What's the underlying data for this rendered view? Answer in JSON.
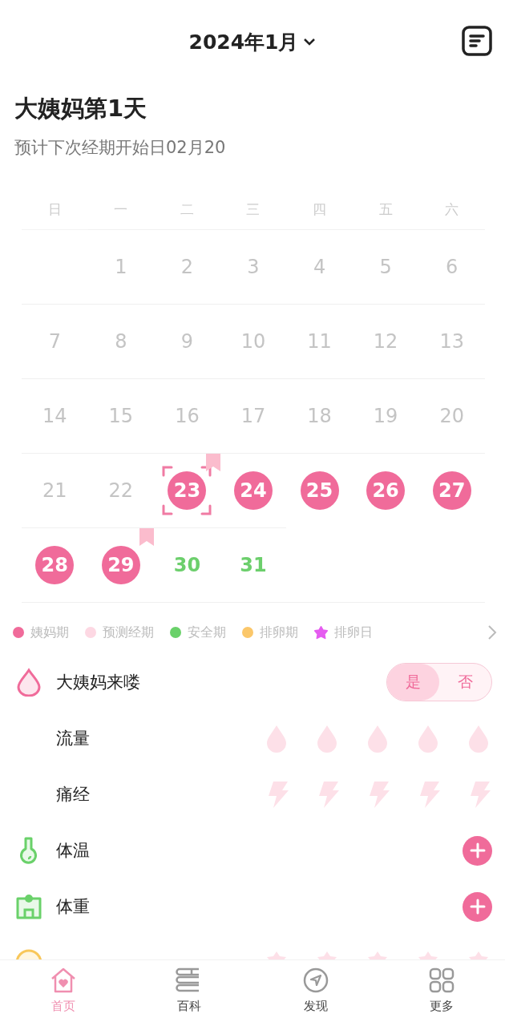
{
  "header": {
    "title": "2024年1月"
  },
  "summary": {
    "title": "大姨妈第1天",
    "subtitle": "预计下次经期开始日02月20"
  },
  "calendar": {
    "weekdays": [
      "日",
      "一",
      "二",
      "三",
      "四",
      "五",
      "六"
    ],
    "days": [
      {
        "kind": "blank"
      },
      {
        "kind": "plain",
        "label": "1",
        "today": false,
        "flag": false
      },
      {
        "kind": "plain",
        "label": "2",
        "today": false,
        "flag": false
      },
      {
        "kind": "plain",
        "label": "3",
        "today": false,
        "flag": false
      },
      {
        "kind": "plain",
        "label": "4",
        "today": false,
        "flag": false
      },
      {
        "kind": "plain",
        "label": "5",
        "today": false,
        "flag": false
      },
      {
        "kind": "plain",
        "label": "6",
        "today": false,
        "flag": false
      },
      {
        "kind": "plain",
        "label": "7",
        "today": false,
        "flag": false
      },
      {
        "kind": "plain",
        "label": "8",
        "today": false,
        "flag": false
      },
      {
        "kind": "plain",
        "label": "9",
        "today": false,
        "flag": false
      },
      {
        "kind": "plain",
        "label": "10",
        "today": false,
        "flag": false
      },
      {
        "kind": "plain",
        "label": "11",
        "today": false,
        "flag": false
      },
      {
        "kind": "plain",
        "label": "12",
        "today": false,
        "flag": false
      },
      {
        "kind": "plain",
        "label": "13",
        "today": false,
        "flag": false
      },
      {
        "kind": "plain",
        "label": "14",
        "today": false,
        "flag": false
      },
      {
        "kind": "plain",
        "label": "15",
        "today": false,
        "flag": false
      },
      {
        "kind": "plain",
        "label": "16",
        "today": false,
        "flag": false
      },
      {
        "kind": "plain",
        "label": "17",
        "today": false,
        "flag": false
      },
      {
        "kind": "plain",
        "label": "18",
        "today": false,
        "flag": false
      },
      {
        "kind": "plain",
        "label": "19",
        "today": false,
        "flag": false
      },
      {
        "kind": "plain",
        "label": "20",
        "today": false,
        "flag": false
      },
      {
        "kind": "plain",
        "label": "21",
        "today": false,
        "flag": false
      },
      {
        "kind": "plain",
        "label": "22",
        "today": false,
        "flag": false
      },
      {
        "kind": "period",
        "label": "23",
        "today": true,
        "flag": true
      },
      {
        "kind": "period",
        "label": "24",
        "today": false,
        "flag": false
      },
      {
        "kind": "period",
        "label": "25",
        "today": false,
        "flag": false
      },
      {
        "kind": "period",
        "label": "26",
        "today": false,
        "flag": false
      },
      {
        "kind": "period",
        "label": "27",
        "today": false,
        "flag": false
      },
      {
        "kind": "period",
        "label": "28",
        "today": false,
        "flag": false
      },
      {
        "kind": "period",
        "label": "29",
        "today": false,
        "flag": true
      },
      {
        "kind": "safe",
        "label": "30",
        "today": false,
        "flag": false
      },
      {
        "kind": "safe",
        "label": "31",
        "today": false,
        "flag": false
      }
    ]
  },
  "legend": [
    {
      "kind": "dot",
      "label": "姨妈期",
      "color": "#f06b9a"
    },
    {
      "kind": "dot",
      "label": "预测经期",
      "color": "#fdd8e3"
    },
    {
      "kind": "dot",
      "label": "安全期",
      "color": "#6ad16a"
    },
    {
      "kind": "dot",
      "label": "排卵期",
      "color": "#fbc76a"
    },
    {
      "kind": "flower",
      "label": "排卵日",
      "color": "#e55cf0"
    }
  ],
  "records": [
    {
      "kind": "toggle",
      "label": "大姨妈来喽",
      "options": [
        {
          "label": "是",
          "selected": true
        },
        {
          "label": "否",
          "selected": false
        }
      ]
    },
    {
      "kind": "drops",
      "label": "流量"
    },
    {
      "kind": "bolts",
      "label": "痛经"
    },
    {
      "kind": "add",
      "label": "体温"
    },
    {
      "kind": "add",
      "label": "体重"
    },
    {
      "kind": "flowers"
    }
  ],
  "nav": [
    {
      "label": "首页",
      "selected": true
    },
    {
      "label": "百科",
      "selected": false
    },
    {
      "label": "发现",
      "selected": false
    },
    {
      "label": "更多",
      "selected": false
    }
  ]
}
